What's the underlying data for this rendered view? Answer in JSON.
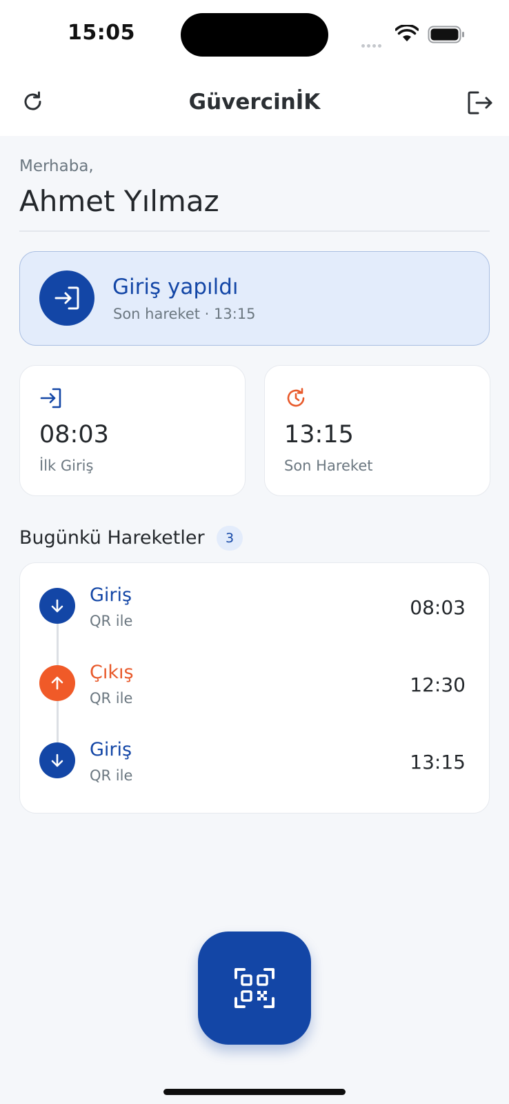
{
  "status_bar": {
    "time": "15:05"
  },
  "header": {
    "title": "GüvercinİK",
    "refresh_icon": "refresh-icon",
    "logout_icon": "logout-icon"
  },
  "greeting": {
    "salutation": "Merhaba,",
    "user_name": "Ahmet Yılmaz"
  },
  "status_card": {
    "title": "Giriş yapıldı",
    "subtitle": "Son hareket · 13:15",
    "icon": "login-icon"
  },
  "summary": [
    {
      "value": "08:03",
      "label": "İlk Giriş",
      "icon": "login-icon",
      "color": "#1346A6"
    },
    {
      "value": "13:15",
      "label": "Son Hareket",
      "icon": "history-clock-icon",
      "color": "#E8592A"
    }
  ],
  "movements_section": {
    "title": "Bugünkü Hareketler",
    "count": "3"
  },
  "movements": [
    {
      "type": "Giriş",
      "method": "QR ile",
      "time": "08:03",
      "direction": "in"
    },
    {
      "type": "Çıkış",
      "method": "QR ile",
      "time": "12:30",
      "direction": "out"
    },
    {
      "type": "Giriş",
      "method": "QR ile",
      "time": "13:15",
      "direction": "in"
    }
  ],
  "fab": {
    "icon": "qr-scan-icon"
  },
  "colors": {
    "primary": "#1346A6",
    "accent": "#F05A28",
    "background": "#F5F7FA",
    "card_highlight": "#E3ECFB"
  }
}
